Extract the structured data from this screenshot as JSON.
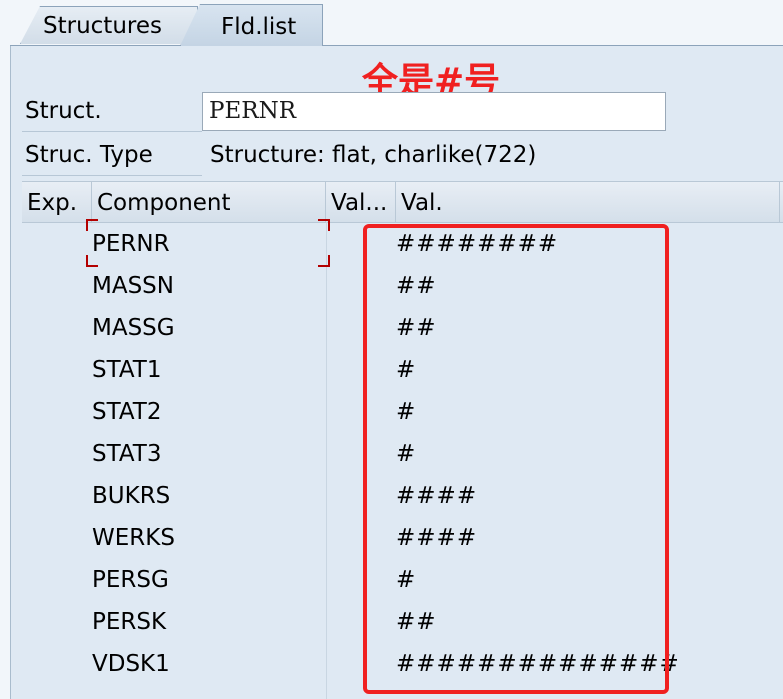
{
  "tabs": [
    {
      "label": "Structures",
      "active": false
    },
    {
      "label": "Fld.list",
      "active": true
    }
  ],
  "annotation": "全是#号",
  "form": {
    "struct_label": "Struct.",
    "struct_value": "PERNR",
    "struc_type_label": "Struc. Type",
    "struc_type_value": "Structure: flat, charlike(722)"
  },
  "table": {
    "headers": {
      "exp": "Exp.",
      "component": "Component",
      "val_short": "Val...",
      "val": "Val."
    },
    "rows": [
      {
        "component": "PERNR",
        "value": "########"
      },
      {
        "component": "MASSN",
        "value": "##"
      },
      {
        "component": "MASSG",
        "value": "##"
      },
      {
        "component": "STAT1",
        "value": "#"
      },
      {
        "component": "STAT2",
        "value": "#"
      },
      {
        "component": "STAT3",
        "value": "#"
      },
      {
        "component": "BUKRS",
        "value": "####"
      },
      {
        "component": "WERKS",
        "value": "####"
      },
      {
        "component": "PERSG",
        "value": "#"
      },
      {
        "component": "PERSK",
        "value": "##"
      },
      {
        "component": "VDSK1",
        "value": "##############"
      }
    ]
  },
  "colors": {
    "annotation": "#f02020",
    "highlight_box": "#f02020",
    "focus_bracket": "#b30000"
  }
}
